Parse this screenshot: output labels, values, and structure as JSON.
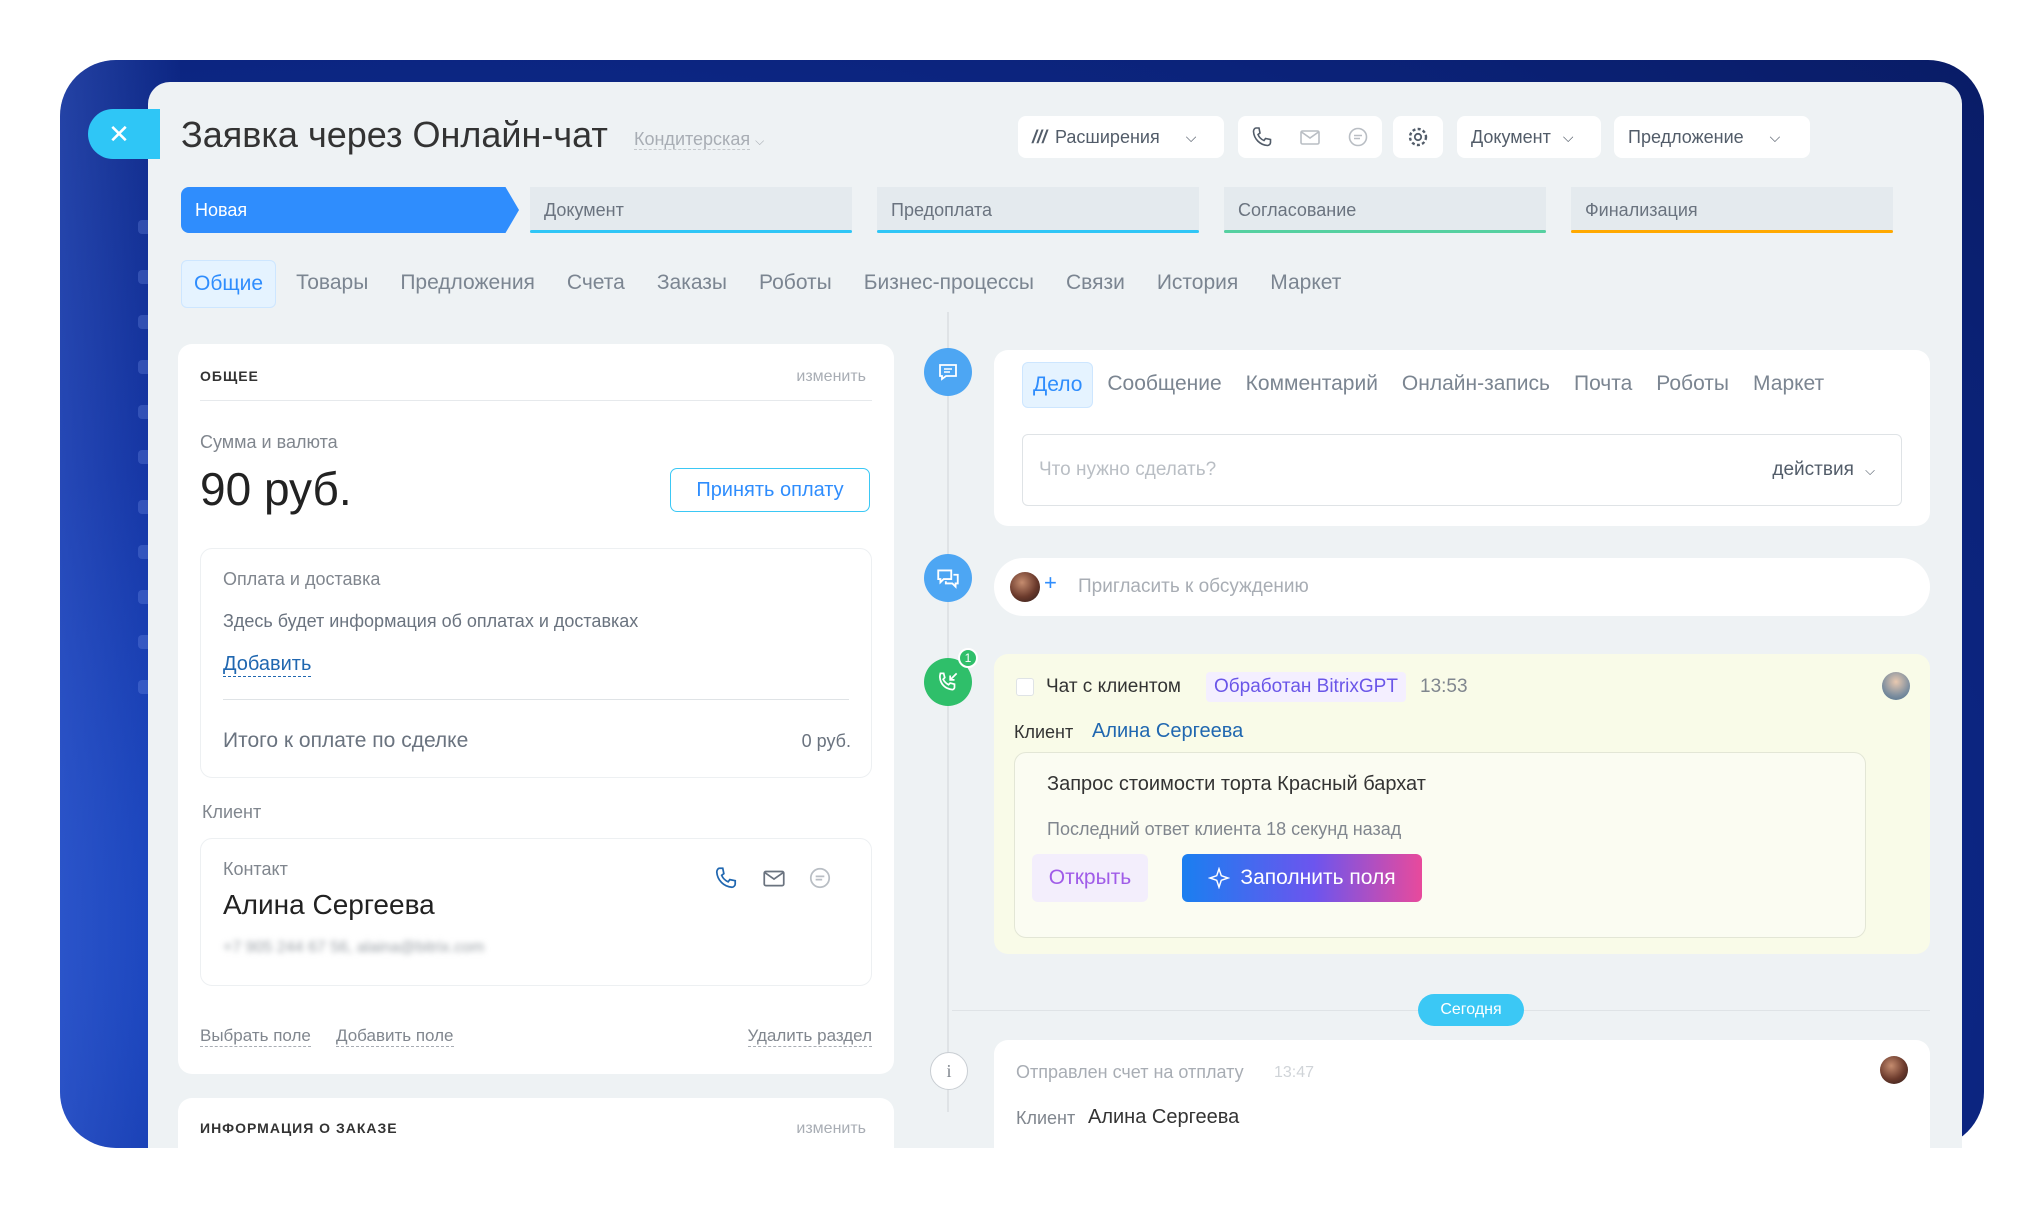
{
  "header": {
    "title": "Заявка через Онлайн-чат",
    "category": "Кондитерская",
    "extensions_label": "Расширения",
    "document_label": "Документ",
    "proposal_label": "Предложение"
  },
  "stages": [
    {
      "label": "Новая",
      "color": "#2f8dfd"
    },
    {
      "label": "Документ",
      "color": "#2fc6f6"
    },
    {
      "label": "Предоплата",
      "color": "#2fc6f6"
    },
    {
      "label": "Согласование",
      "color": "#55d0a0"
    },
    {
      "label": "Финализация",
      "color": "#ffa900"
    }
  ],
  "tabs": [
    "Общие",
    "Товары",
    "Предложения",
    "Счета",
    "Заказы",
    "Роботы",
    "Бизнес-процессы",
    "Связи",
    "История",
    "Маркет"
  ],
  "general": {
    "title": "ОБЩЕЕ",
    "edit": "изменить",
    "amount_label": "Сумма и валюта",
    "amount": "90 руб.",
    "accept_payment": "Принять оплату",
    "payment": {
      "title": "Оплата и доставка",
      "info": "Здесь будет информация об оплатах и доставках",
      "add": "Добавить",
      "total_label": "Итого к оплате по сделке",
      "total_value": "0 руб."
    },
    "client_label": "Клиент",
    "contact": {
      "label": "Контакт",
      "name": "Алина Сергеева",
      "details_blurred": "+7 905 244 67 56, alaina@bitrix.com"
    },
    "choose_field": "Выбрать поле",
    "add_field": "Добавить поле",
    "delete_section": "Удалить раздел"
  },
  "order_info": {
    "title": "ИНФОРМАЦИЯ О ЗАКАЗЕ",
    "edit": "изменить"
  },
  "editor": {
    "tabs": [
      "Дело",
      "Сообщение",
      "Комментарий",
      "Онлайн-запись",
      "Почта",
      "Роботы",
      "Маркет"
    ],
    "placeholder": "Что нужно сделать?",
    "actions": "действия"
  },
  "invite": {
    "text": "Пригласить к обсуждению"
  },
  "chat_item": {
    "badge_count": "1",
    "title": "Чат с клиентом",
    "processed": "Обработан BitrixGPT",
    "time": "13:53",
    "client_label": "Клиент",
    "client_name": "Алина Сергеева",
    "request": "Запрос стоимости торта Красный бархат",
    "last_reply": "Последний ответ клиента 18 секунд назад",
    "open": "Открыть",
    "fill_fields": "Заполнить поля"
  },
  "today": "Сегодня",
  "invoice_item": {
    "title": "Отправлен счет на отплату",
    "time": "13:47",
    "client_label": "Клиент",
    "client_name": "Алина Сергеева"
  }
}
